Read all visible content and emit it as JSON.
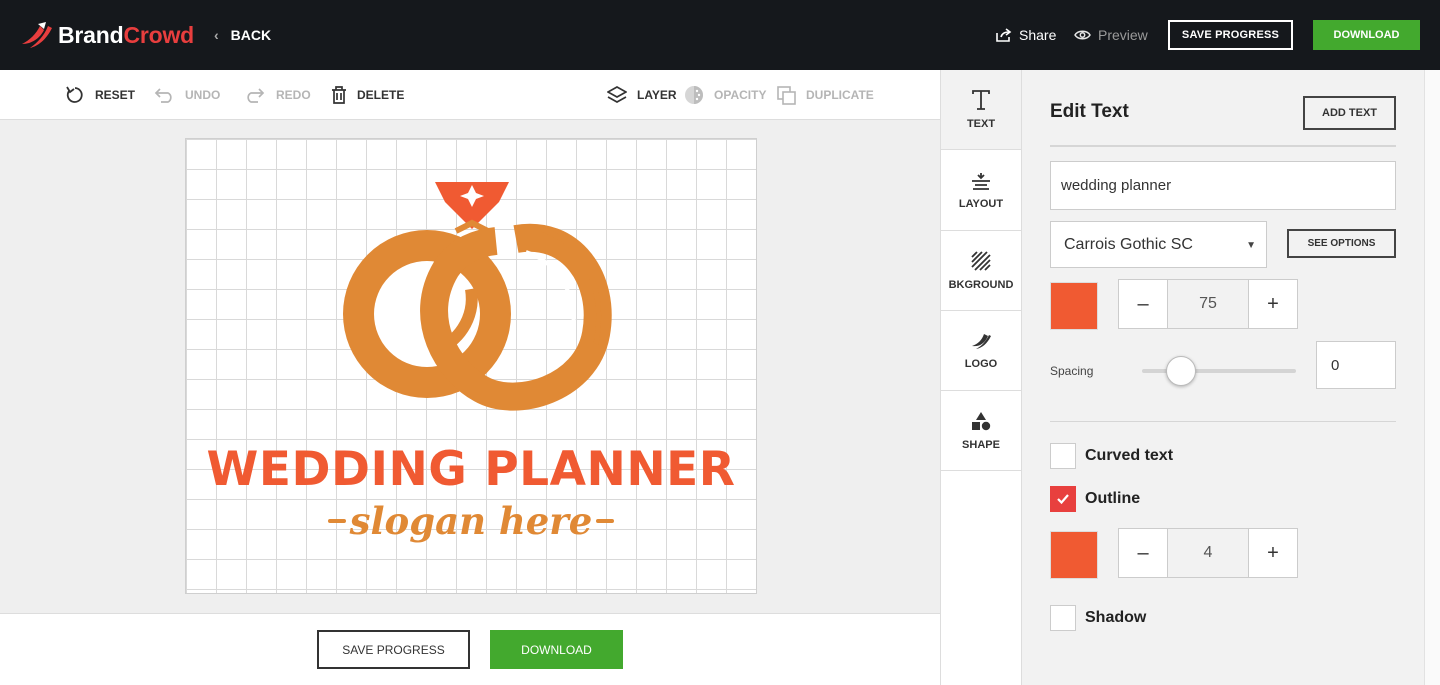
{
  "header": {
    "brand_part1": "Brand",
    "brand_part2": "Crowd",
    "back_label": "BACK",
    "share_label": "Share",
    "preview_label": "Preview",
    "save_progress_label": "SAVE PROGRESS",
    "download_label": "DOWNLOAD"
  },
  "toolbar": {
    "reset": "RESET",
    "undo": "UNDO",
    "redo": "REDO",
    "delete": "DELETE",
    "layer": "LAYER",
    "opacity": "OPACITY",
    "duplicate": "DUPLICATE"
  },
  "canvas": {
    "logo_text": "WEDDING PLANNER",
    "slogan_text": "slogan here",
    "colors": {
      "primary": "#f05a32",
      "secondary": "#e08935",
      "gem": "#f05a32"
    }
  },
  "footer": {
    "save_progress_label": "SAVE PROGRESS",
    "download_label": "DOWNLOAD"
  },
  "side_tabs": {
    "items": [
      {
        "label": "TEXT",
        "icon": "text-icon",
        "active": true
      },
      {
        "label": "LAYOUT",
        "icon": "layout-icon",
        "active": false
      },
      {
        "label": "BKGROUND",
        "icon": "background-icon",
        "active": false
      },
      {
        "label": "LOGO",
        "icon": "logo-icon",
        "active": false
      },
      {
        "label": "SHAPE",
        "icon": "shape-icon",
        "active": false
      }
    ]
  },
  "panel": {
    "title": "Edit Text",
    "add_text_label": "ADD TEXT",
    "text_value": "wedding planner",
    "font_name": "Carrois Gothic SC",
    "see_options_label": "SEE OPTIONS",
    "text_color": "#f05a32",
    "font_size": "75",
    "spacing_label": "Spacing",
    "spacing_value": "0",
    "curved_text_label": "Curved text",
    "curved_text_checked": false,
    "outline_label": "Outline",
    "outline_checked": true,
    "outline_color": "#f05a32",
    "outline_size": "4",
    "shadow_label": "Shadow",
    "shadow_checked": false
  },
  "colors": {
    "topbar_bg": "#15181c",
    "accent_green": "#43a92e",
    "brand_red": "#e83e3e",
    "checkbox_red": "#e8403e"
  }
}
